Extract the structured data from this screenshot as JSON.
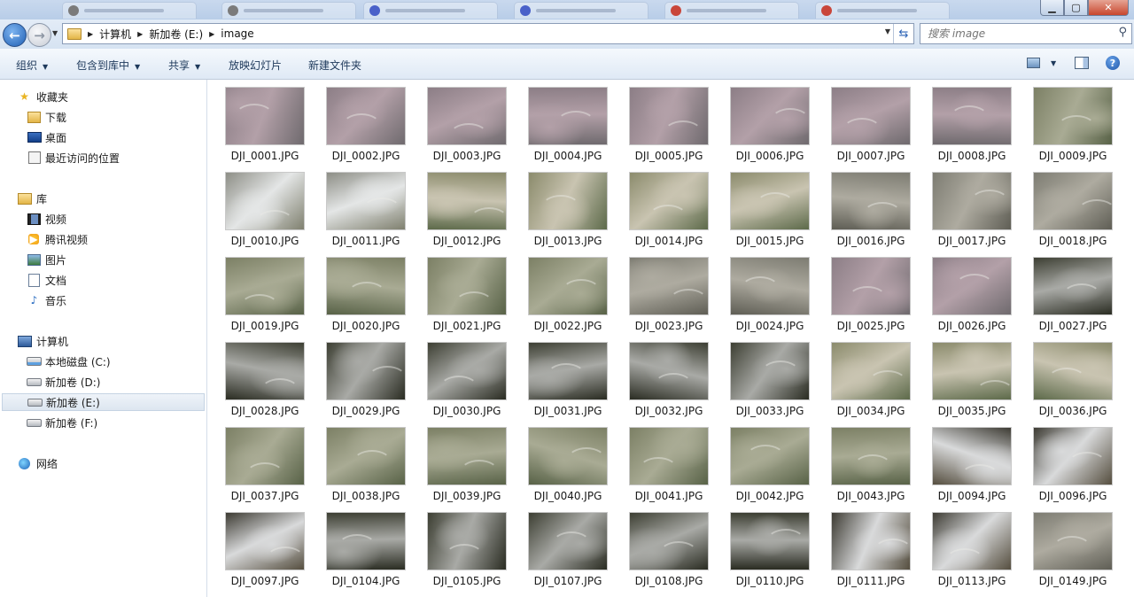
{
  "window": {
    "controls": {
      "minimize": "▁",
      "maximize": "▢",
      "close": "✕"
    }
  },
  "address": {
    "breadcrumb": [
      "计算机",
      "新加卷 (E:)",
      "image"
    ],
    "search_placeholder": "搜索 image"
  },
  "toolbar": {
    "organize": "组织",
    "include_library": "包含到库中",
    "share": "共享",
    "slideshow": "放映幻灯片",
    "new_folder": "新建文件夹"
  },
  "sidebar": {
    "favorites": {
      "label": "收藏夹",
      "items": [
        "下载",
        "桌面",
        "最近访问的位置"
      ]
    },
    "libraries": {
      "label": "库",
      "items": [
        "视频",
        "腾讯视频",
        "图片",
        "文档",
        "音乐"
      ]
    },
    "computer": {
      "label": "计算机",
      "items": [
        "本地磁盘 (C:)",
        "新加卷 (D:)",
        "新加卷 (E:)",
        "新加卷 (F:)"
      ],
      "selected": "新加卷 (E:)"
    },
    "network": {
      "label": "网络"
    }
  },
  "files": [
    {
      "name": "DJI_0001.JPG",
      "tone": "pink"
    },
    {
      "name": "DJI_0002.JPG",
      "tone": "pink"
    },
    {
      "name": "DJI_0003.JPG",
      "tone": "pink"
    },
    {
      "name": "DJI_0004.JPG",
      "tone": "pink"
    },
    {
      "name": "DJI_0005.JPG",
      "tone": "pink"
    },
    {
      "name": "DJI_0006.JPG",
      "tone": "pink"
    },
    {
      "name": "DJI_0007.JPG",
      "tone": "pink"
    },
    {
      "name": "DJI_0008.JPG",
      "tone": "pink"
    },
    {
      "name": "DJI_0009.JPG",
      "tone": "green"
    },
    {
      "name": "DJI_0010.JPG",
      "tone": "snow"
    },
    {
      "name": "DJI_0011.JPG",
      "tone": "snow"
    },
    {
      "name": "DJI_0012.JPG",
      "tone": "mixed"
    },
    {
      "name": "DJI_0013.JPG",
      "tone": "mixed"
    },
    {
      "name": "DJI_0014.JPG",
      "tone": "mixed"
    },
    {
      "name": "DJI_0015.JPG",
      "tone": "mixed"
    },
    {
      "name": "DJI_0016.JPG",
      "tone": "gray"
    },
    {
      "name": "DJI_0017.JPG",
      "tone": "gray"
    },
    {
      "name": "DJI_0018.JPG",
      "tone": "gray"
    },
    {
      "name": "DJI_0019.JPG",
      "tone": "green"
    },
    {
      "name": "DJI_0020.JPG",
      "tone": "green"
    },
    {
      "name": "DJI_0021.JPG",
      "tone": "green"
    },
    {
      "name": "DJI_0022.JPG",
      "tone": "green"
    },
    {
      "name": "DJI_0023.JPG",
      "tone": "gray"
    },
    {
      "name": "DJI_0024.JPG",
      "tone": "gray"
    },
    {
      "name": "DJI_0025.JPG",
      "tone": "pink"
    },
    {
      "name": "DJI_0026.JPG",
      "tone": "pink"
    },
    {
      "name": "DJI_0027.JPG",
      "tone": "dark"
    },
    {
      "name": "DJI_0028.JPG",
      "tone": "dark"
    },
    {
      "name": "DJI_0029.JPG",
      "tone": "dark"
    },
    {
      "name": "DJI_0030.JPG",
      "tone": "dark"
    },
    {
      "name": "DJI_0031.JPG",
      "tone": "dark"
    },
    {
      "name": "DJI_0032.JPG",
      "tone": "dark"
    },
    {
      "name": "DJI_0033.JPG",
      "tone": "dark"
    },
    {
      "name": "DJI_0034.JPG",
      "tone": "mixed"
    },
    {
      "name": "DJI_0035.JPG",
      "tone": "mixed"
    },
    {
      "name": "DJI_0036.JPG",
      "tone": "mixed"
    },
    {
      "name": "DJI_0037.JPG",
      "tone": "green"
    },
    {
      "name": "DJI_0038.JPG",
      "tone": "green"
    },
    {
      "name": "DJI_0039.JPG",
      "tone": "green"
    },
    {
      "name": "DJI_0040.JPG",
      "tone": "green"
    },
    {
      "name": "DJI_0041.JPG",
      "tone": "green"
    },
    {
      "name": "DJI_0042.JPG",
      "tone": "green"
    },
    {
      "name": "DJI_0043.JPG",
      "tone": "green"
    },
    {
      "name": "DJI_0094.JPG",
      "tone": "river"
    },
    {
      "name": "DJI_0096.JPG",
      "tone": "river"
    },
    {
      "name": "DJI_0097.JPG",
      "tone": "river"
    },
    {
      "name": "DJI_0104.JPG",
      "tone": "dark"
    },
    {
      "name": "DJI_0105.JPG",
      "tone": "dark"
    },
    {
      "name": "DJI_0107.JPG",
      "tone": "dark"
    },
    {
      "name": "DJI_0108.JPG",
      "tone": "dark"
    },
    {
      "name": "DJI_0110.JPG",
      "tone": "dark"
    },
    {
      "name": "DJI_0111.JPG",
      "tone": "river"
    },
    {
      "name": "DJI_0113.JPG",
      "tone": "river"
    },
    {
      "name": "DJI_0149.JPG",
      "tone": "gray"
    }
  ],
  "tone_colors": {
    "pink": [
      "#8c7e86",
      "#b3a0a8",
      "#6f6a6e"
    ],
    "snow": [
      "#8d8e86",
      "#e4e6e6",
      "#7f806f"
    ],
    "mixed": [
      "#8b8b6c",
      "#c9c4b1",
      "#5d6a4a"
    ],
    "gray": [
      "#7d7c72",
      "#aeaba0",
      "#5f5e55"
    ],
    "green": [
      "#7c8065",
      "#a9ab94",
      "#586247"
    ],
    "dark": [
      "#3d3f33",
      "#a9aaa6",
      "#2a2c22"
    ],
    "river": [
      "#3d3b33",
      "#d9dadb",
      "#554e3f"
    ]
  }
}
